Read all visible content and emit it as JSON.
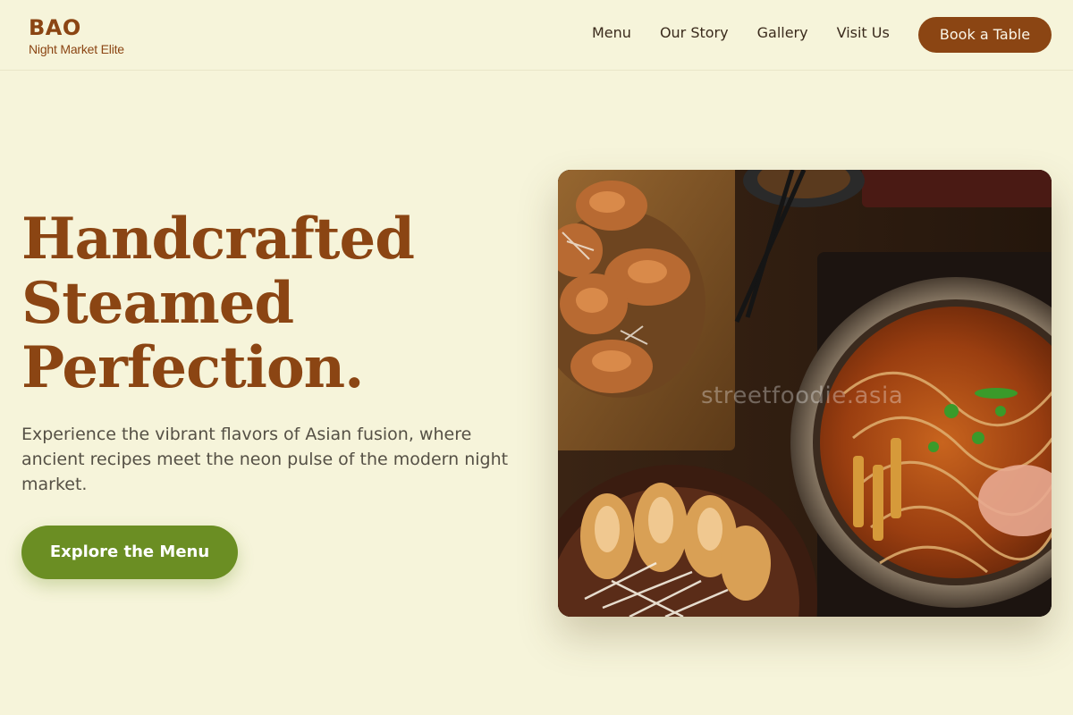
{
  "header": {
    "brand_name": "BAO",
    "brand_tagline": "Night Market Elite",
    "nav": [
      {
        "label": "Menu"
      },
      {
        "label": "Our Story"
      },
      {
        "label": "Gallery"
      },
      {
        "label": "Visit Us"
      }
    ],
    "book_label": "Book a Table"
  },
  "hero": {
    "title_lines": [
      "Handcrafted",
      "Steamed",
      "Perfection."
    ],
    "description": "Experience the vibrant flavors of Asian fusion, where ancient recipes meet the neon pulse of the modern night market.",
    "cta_label": "Explore the Menu",
    "image_watermark": "streetfoodie.asia"
  },
  "colors": {
    "background": "#f6f4da",
    "brand_brown": "#8b4513",
    "accent_green": "#6b8e23"
  }
}
